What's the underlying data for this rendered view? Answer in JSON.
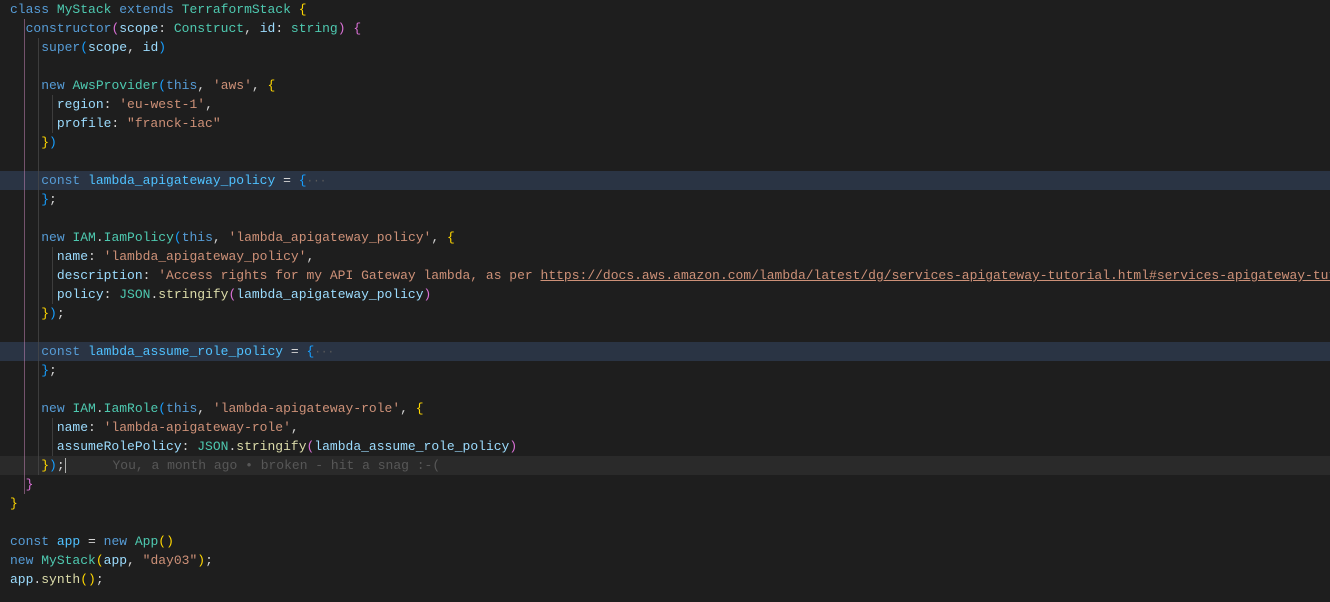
{
  "code": {
    "l1_class": "class",
    "l1_name": "MyStack",
    "l1_extends": "extends",
    "l1_super": "TerraformStack",
    "l2_ctor": "constructor",
    "l2_scope": "scope",
    "l2_scope_t": "Construct",
    "l2_id": "id",
    "l2_id_t": "string",
    "l3_super": "super",
    "l3_scope": "scope",
    "l3_id": "id",
    "l5_new": "new",
    "l5_cls": "AwsProvider",
    "l5_this": "this",
    "l5_s": "'aws'",
    "l6_k": "region",
    "l6_v": "'eu-west-1'",
    "l7_k": "profile",
    "l7_v": "\"franck-iac\"",
    "l10_const": "const",
    "l10_name": "lambda_apigateway_policy",
    "l10_fold": "···",
    "l11_close": "};",
    "l13_new": "new",
    "l13_ns": "IAM",
    "l13_cls": "IamPolicy",
    "l13_this": "this",
    "l13_s": "'lambda_apigateway_policy'",
    "l14_k": "name",
    "l14_v": "'lambda_apigateway_policy'",
    "l15_k": "description",
    "l15_v_a": "'Access rights for my API Gateway lambda, as per ",
    "l15_url": "https://docs.aws.amazon.com/lambda/latest/dg/services-apigateway-tutorial.html#services-apigateway-tutor",
    "l16_k": "policy",
    "l16_json": "JSON",
    "l16_fn": "stringify",
    "l16_arg": "lambda_apigateway_policy",
    "l17_close": "});",
    "l19_const": "const",
    "l19_name": "lambda_assume_role_policy",
    "l19_fold": "···",
    "l20_close": "};",
    "l22_new": "new",
    "l22_ns": "IAM",
    "l22_cls": "IamRole",
    "l22_this": "this",
    "l22_s": "'lambda-apigateway-role'",
    "l23_k": "name",
    "l23_v": "'lambda-apigateway-role'",
    "l24_k": "assumeRolePolicy",
    "l24_json": "JSON",
    "l24_fn": "stringify",
    "l24_arg": "lambda_assume_role_policy",
    "l25_close": "});",
    "l25_lens": "You, a month ago • broken - hit a snag :-(",
    "l30_const": "const",
    "l30_var": "app",
    "l30_new": "new",
    "l30_cls": "App",
    "l31_new": "new",
    "l31_cls": "MyStack",
    "l31_arg1": "app",
    "l31_arg2": "\"day03\"",
    "l32_obj": "app",
    "l32_fn": "synth"
  }
}
